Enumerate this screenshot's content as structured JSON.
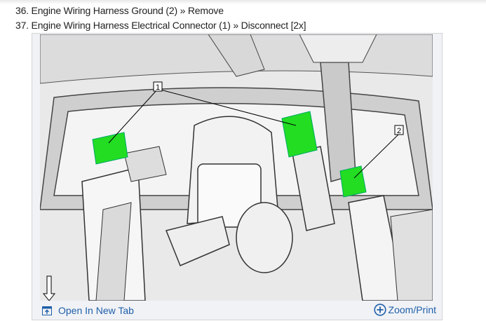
{
  "steps": [
    {
      "text": "36. Engine Wiring Harness Ground (2) » Remove"
    },
    {
      "text": "37. Engine Wiring Harness Electrical Connector (1) » Disconnect [2x]"
    }
  ],
  "figure": {
    "callouts": [
      "1",
      "2"
    ],
    "highlight_color": "#22dd22"
  },
  "footer": {
    "open_tab_label": "Open In New Tab",
    "zoom_label": "Zoom/Print",
    "link_color": "#1f5fa8"
  }
}
